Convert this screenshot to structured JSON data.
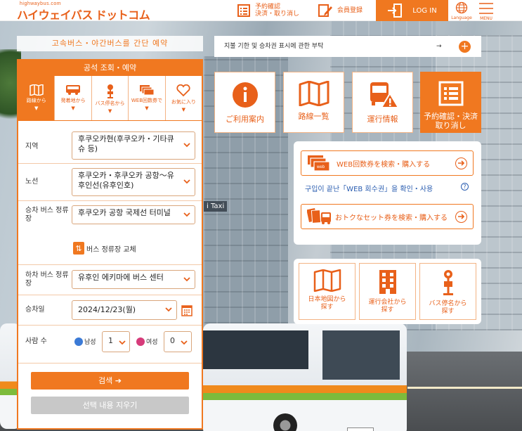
{
  "header": {
    "logo_small": "highwaybus.com",
    "logo": "ハイウェイバス ドットコム",
    "reserve_confirm_line1": "予約確認",
    "reserve_confirm_line2": "決済・取り消し",
    "member_register": "会員登録",
    "login": "LOG IN",
    "language": "Language",
    "menu": "MENU"
  },
  "search": {
    "banner": "고속버스・야간버스를 간단 예약",
    "panel_title": "공석 조회・예약",
    "tabs": [
      {
        "label": "路線から",
        "icon": "map-icon",
        "active": true
      },
      {
        "label": "発着地から",
        "icon": "bus-icon",
        "active": false
      },
      {
        "label": "バス停名から",
        "icon": "bus-stop-icon",
        "active": false
      },
      {
        "label": "WEB回数券で",
        "icon": "ticket-icon",
        "active": false
      },
      {
        "label": "お気に入り",
        "icon": "heart-icon",
        "active": false
      }
    ],
    "region_label": "지역",
    "region_value": "후쿠오카현(후쿠오카・기타큐슈 등)",
    "route_label": "노선",
    "route_value": "후쿠오카・후쿠오카 공항～유후인선(유후인호)",
    "board_label": "승차 버스 정류장",
    "board_value": "후쿠오카 공항 국제선 터미널",
    "swap_label": "버스 정류장 교체",
    "alight_label": "하차 버스 정류장",
    "alight_value": "유후인 에키마에 버스 센터",
    "date_label": "승차일",
    "date_value": "2024/12/23(월)",
    "people_label": "사람 수",
    "male_label": "남성",
    "male_value": "1",
    "female_label": "여성",
    "female_value": "0",
    "search_button": "검색",
    "clear_button": "선택 내용 지우기"
  },
  "notice": {
    "text": "지불 기한 및 승차권 표시에 관한 부탁",
    "arrow": "→"
  },
  "tiles": [
    {
      "label": "ご利用案内",
      "icon": "info-icon",
      "dark": false
    },
    {
      "label": "路線一覧",
      "icon": "map-icon",
      "dark": false
    },
    {
      "label": "運行情報",
      "icon": "bus-warning-icon",
      "dark": false
    },
    {
      "label_line1": "予約確認・決済",
      "label_line2": "取り消し",
      "icon": "list-icon",
      "dark": true
    }
  ],
  "coupon": {
    "web_ticket_button": "WEB回数券を検索・購入する",
    "web_ticket_link": "구입이 끝난「WEB 회수권」을 확인・사용",
    "set_ticket_button": "おトクなセット券を検索・購入する"
  },
  "small_tiles": [
    {
      "line1": "日本地図から",
      "line2": "探す",
      "icon": "map-icon"
    },
    {
      "line1": "運行会社から",
      "line2": "探す",
      "icon": "building-icon"
    },
    {
      "line1": "バス停名から",
      "line2": "探す",
      "icon": "bus-stop-icon"
    }
  ],
  "colors": {
    "accent": "#f07820",
    "link": "#2a5db0"
  }
}
